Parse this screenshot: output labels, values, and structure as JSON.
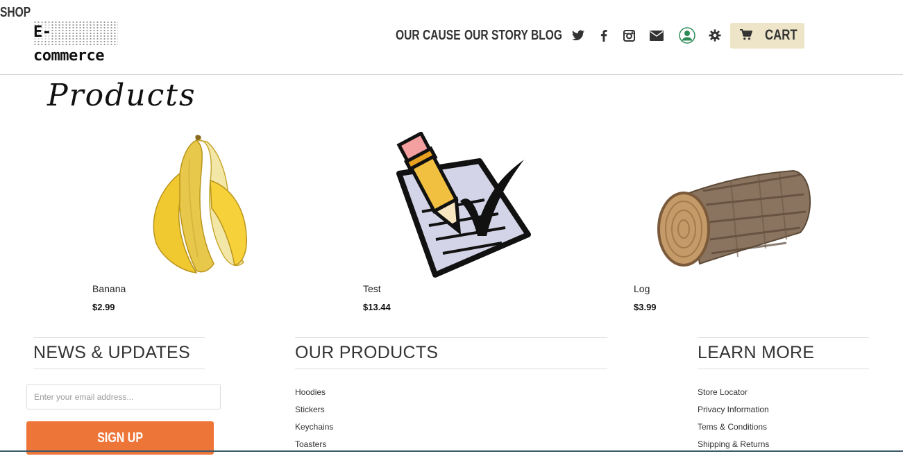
{
  "header": {
    "logo_text": "E-commerce",
    "nav": [
      {
        "label": "SHOP"
      },
      {
        "label": "OUR CAUSE"
      },
      {
        "label": "OUR STORY"
      },
      {
        "label": "BLOG"
      }
    ],
    "social_icons": [
      "twitter-icon",
      "facebook-icon",
      "instagram-icon",
      "envelope-icon"
    ],
    "account_icon": "user-icon",
    "settings_icon": "gear-icon",
    "cart_label": "CART",
    "cart_bg": "#eee5c8"
  },
  "main": {
    "title": "Products",
    "products": [
      {
        "name": "Banana",
        "price": "$2.99",
        "image": "banana"
      },
      {
        "name": "Test",
        "price": "$13.44",
        "image": "checklist-pencil"
      },
      {
        "name": "Log",
        "price": "$3.99",
        "image": "wood-log"
      }
    ]
  },
  "footer": {
    "news": {
      "heading": "NEWS & UPDATES",
      "email_placeholder": "Enter your email address...",
      "signup_label": "SIGN UP",
      "signup_color": "#ee7538"
    },
    "products": {
      "heading": "OUR PRODUCTS",
      "links": [
        "Hoodies",
        "Stickers",
        "Keychains",
        "Toasters"
      ]
    },
    "learn": {
      "heading": "LEARN MORE",
      "links": [
        "Store Locator",
        "Privacy Information",
        "Tems & Conditions",
        "Shipping & Returns"
      ]
    }
  }
}
